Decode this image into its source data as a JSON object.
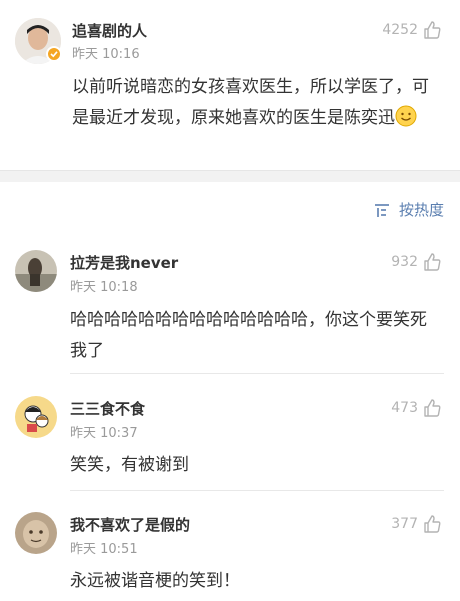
{
  "post": {
    "author": "追喜剧的人",
    "time": "昨天 10:16",
    "likes": "4252",
    "text": "以前听说暗恋的女孩喜欢医生，所以学医了，可是最近才发现，原来她喜欢的医生是陈奕迅"
  },
  "sort": {
    "label": "按热度"
  },
  "comments": [
    {
      "author": "拉芳是我never",
      "time": "昨天 10:18",
      "likes": "932",
      "text": "哈哈哈哈哈哈哈哈哈哈哈哈哈哈，你这个要笑死我了"
    },
    {
      "author": "三三食不食",
      "time": "昨天 10:37",
      "likes": "473",
      "text": "笑笑，有被谢到"
    },
    {
      "author": "我不喜欢了是假的",
      "time": "昨天 10:51",
      "likes": "377",
      "text": "永远被谐音梗的笑到！"
    }
  ]
}
